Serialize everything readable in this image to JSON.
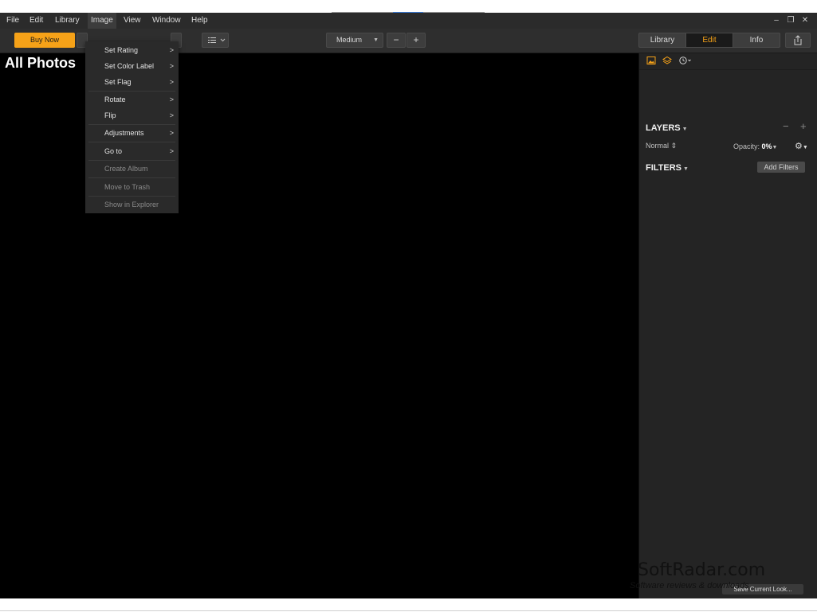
{
  "menubar": {
    "items": [
      {
        "id": "file",
        "label": "File"
      },
      {
        "id": "edit",
        "label": "Edit"
      },
      {
        "id": "library",
        "label": "Library"
      },
      {
        "id": "image",
        "label": "Image"
      },
      {
        "id": "view",
        "label": "View"
      },
      {
        "id": "window",
        "label": "Window"
      },
      {
        "id": "help",
        "label": "Help"
      }
    ],
    "window_controls": {
      "minimize": "–",
      "restore": "❐",
      "close": "✕"
    }
  },
  "toolbar": {
    "buy_now_label": "Buy Now",
    "zoom_value": "Medium",
    "zoom_out_label": "−",
    "zoom_in_label": "+",
    "tabs": [
      {
        "label": "Library"
      },
      {
        "label": "Edit",
        "active": true
      },
      {
        "label": "Info"
      }
    ]
  },
  "main": {
    "title": "All Photos"
  },
  "image_menu": {
    "items": [
      {
        "label": "Set Rating",
        "submenu": true,
        "enabled": true
      },
      {
        "label": "Set Color Label",
        "submenu": true,
        "enabled": true
      },
      {
        "label": "Set Flag",
        "submenu": true,
        "enabled": true
      },
      {
        "label": "Rotate",
        "submenu": true,
        "enabled": true
      },
      {
        "label": "Flip",
        "submenu": true,
        "enabled": true
      },
      {
        "label": "Adjustments",
        "submenu": true,
        "enabled": true
      },
      {
        "label": "Go to",
        "submenu": true,
        "enabled": true
      },
      {
        "label": "Create Album",
        "submenu": false,
        "enabled": false
      },
      {
        "label": "Move to Trash",
        "submenu": false,
        "enabled": false
      },
      {
        "label": "Show in Explorer",
        "submenu": false,
        "enabled": false
      }
    ],
    "submenu_arrow": ">"
  },
  "right_panel": {
    "icons": [
      "image-icon",
      "layers-icon",
      "history-clock-icon"
    ],
    "layers_label": "LAYERS",
    "layer_minus": "−",
    "layer_plus": "+",
    "blend_mode": "Normal",
    "opacity_label": "Opacity:",
    "opacity_value": "0%",
    "filters_label": "FILTERS",
    "add_filters_label": "Add Filters"
  },
  "footer": {
    "save_label": "Save Current Look..."
  },
  "watermark": {
    "title": "SoftRadar.com",
    "subtitle": "Software reviews & downloads"
  },
  "colors": {
    "accent": "#f6a218",
    "panel": "#242424",
    "toolbar": "#2e2e2e",
    "menubar": "#2b2b2b",
    "canvas": "#000000"
  }
}
